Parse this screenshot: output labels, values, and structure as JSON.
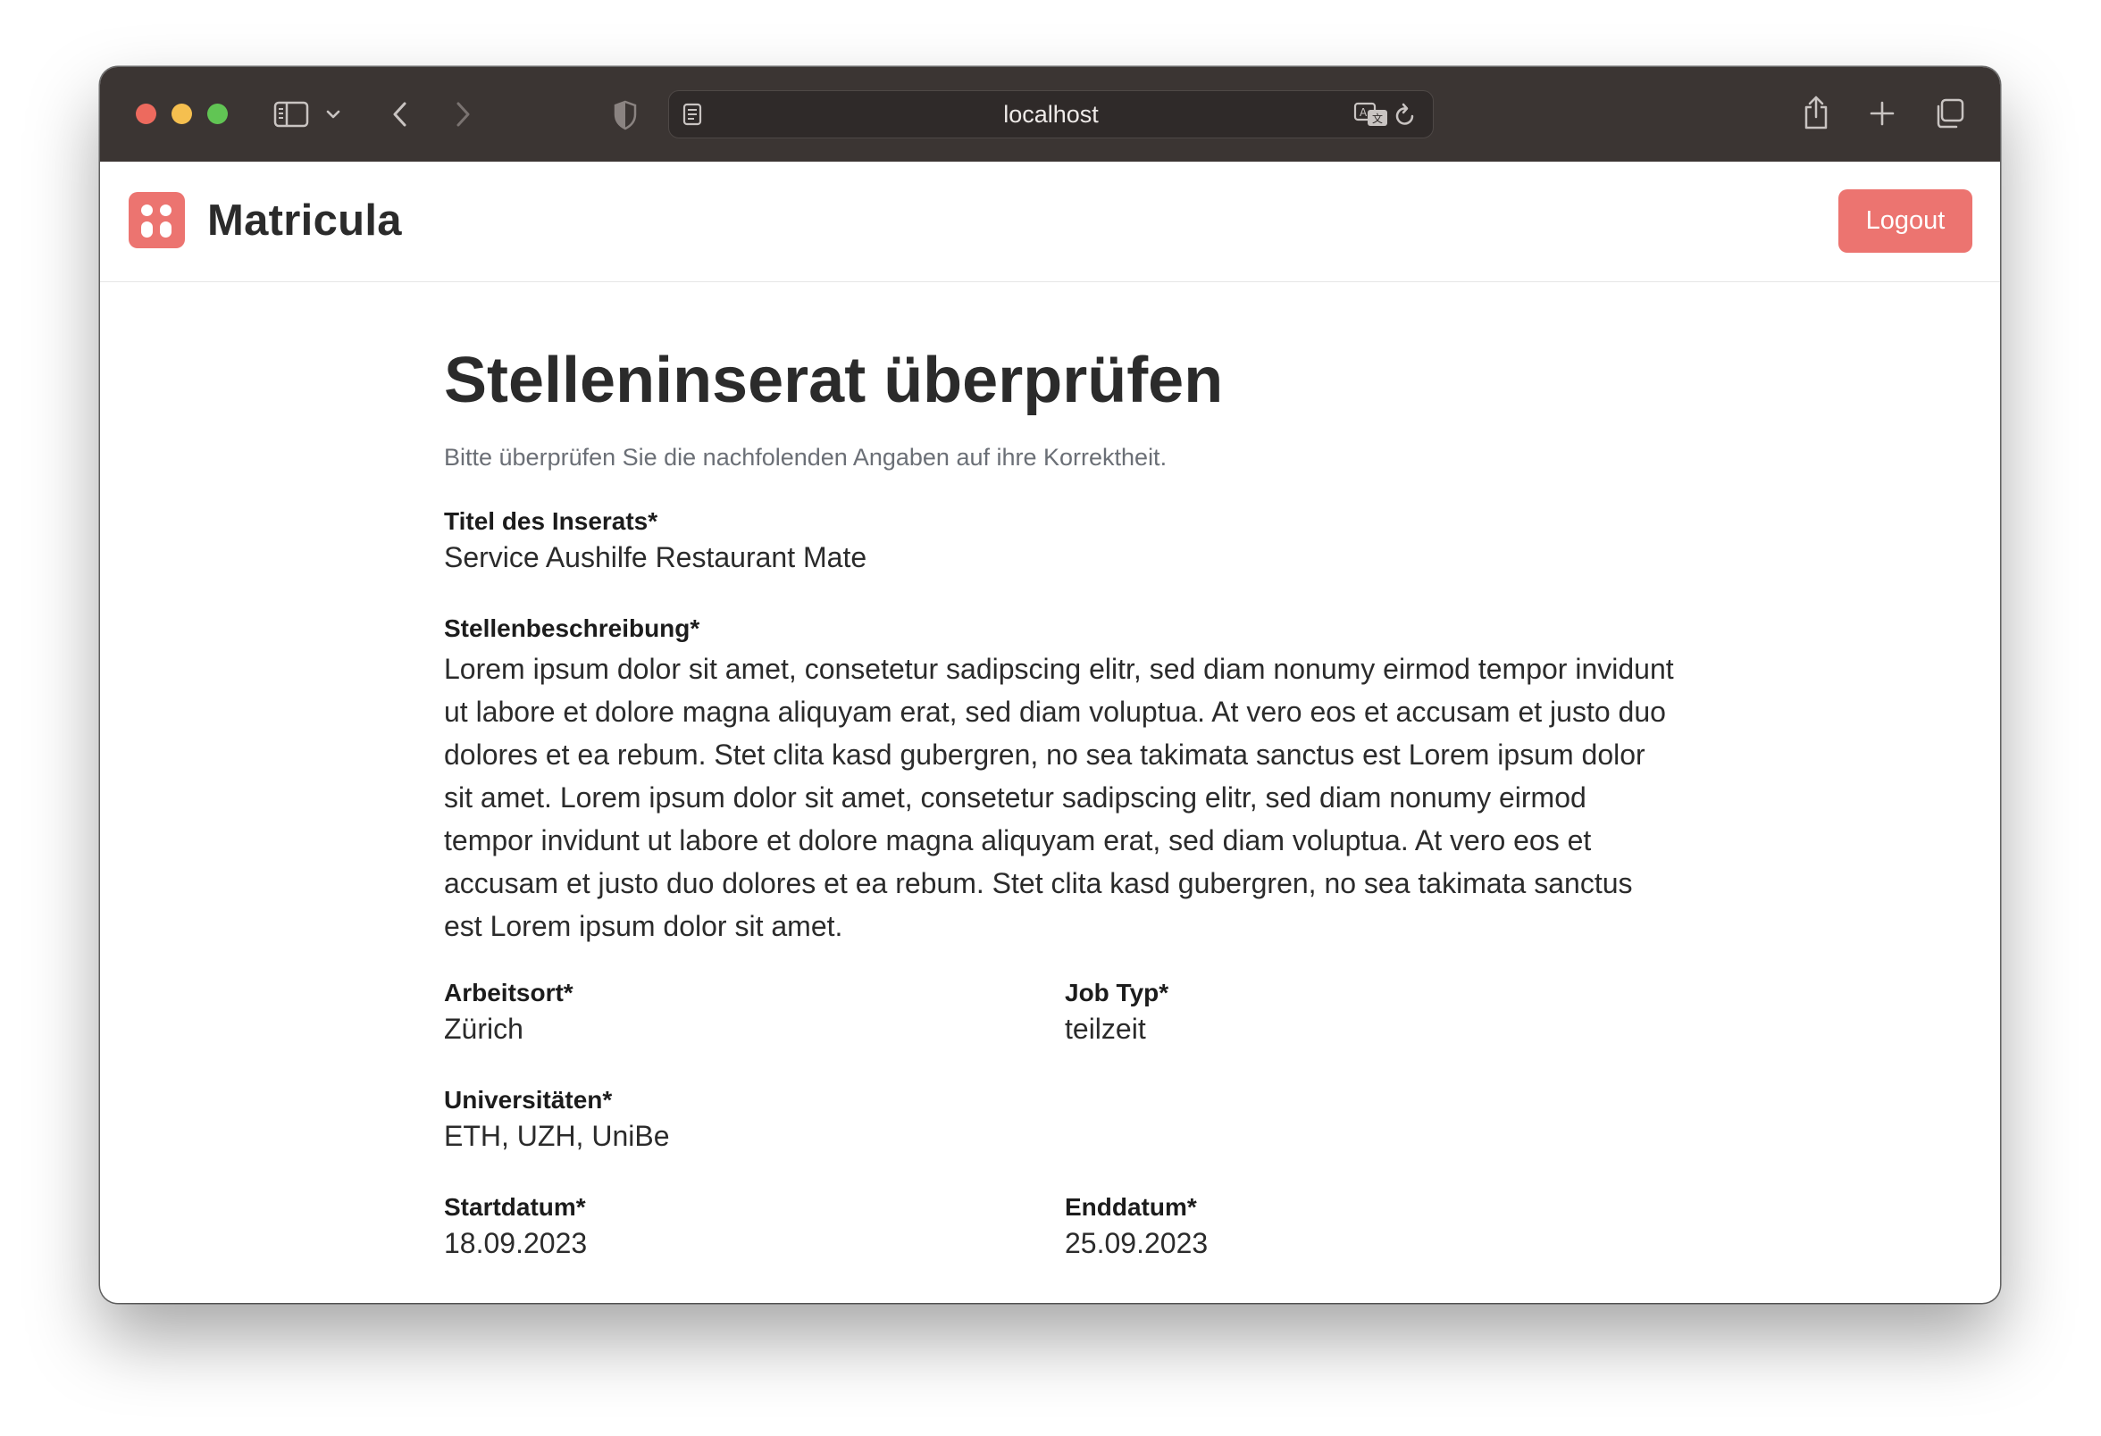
{
  "browser": {
    "url": "localhost",
    "icons": [
      "sidebar-icon",
      "chevron-down-icon",
      "back-icon",
      "forward-icon",
      "shield-icon",
      "reader-icon",
      "translate-icon",
      "reload-icon",
      "share-icon",
      "new-tab-icon",
      "tabs-overview-icon"
    ]
  },
  "header": {
    "brand": "Matricula",
    "logout_label": "Logout",
    "accent_color": "#ec7470"
  },
  "main": {
    "title": "Stelleninserat überprüfen",
    "subtitle": "Bitte überprüfen Sie die nachfolenden Angaben auf ihre Korrektheit.",
    "fields": {
      "titel": {
        "label": "Titel des Inserats*",
        "value": "Service Aushilfe Restaurant Mate"
      },
      "beschreibung": {
        "label": "Stellenbeschreibung*",
        "value": "Lorem ipsum dolor sit amet, consetetur sadipscing elitr, sed diam nonumy eirmod tempor invidunt ut labore et dolore magna aliquyam erat, sed diam voluptua. At vero eos et accusam et justo duo dolores et ea rebum. Stet clita kasd gubergren, no sea takimata sanctus est Lorem ipsum dolor sit amet. Lorem ipsum dolor sit amet, consetetur sadipscing elitr, sed diam nonumy eirmod tempor invidunt ut labore et dolore magna aliquyam erat, sed diam voluptua. At vero eos et accusam et justo duo dolores et ea rebum. Stet clita kasd gubergren, no sea takimata sanctus est Lorem ipsum dolor sit amet."
      },
      "arbeitsort": {
        "label": "Arbeitsort*",
        "value": "Zürich"
      },
      "jobtyp": {
        "label": "Job Typ*",
        "value": "teilzeit"
      },
      "universitaeten": {
        "label": "Universitäten*",
        "value": "ETH, UZH, UniBe"
      },
      "startdatum": {
        "label": "Startdatum*",
        "value": "18.09.2023"
      },
      "enddatum": {
        "label": "Enddatum*",
        "value": "25.09.2023"
      }
    }
  }
}
